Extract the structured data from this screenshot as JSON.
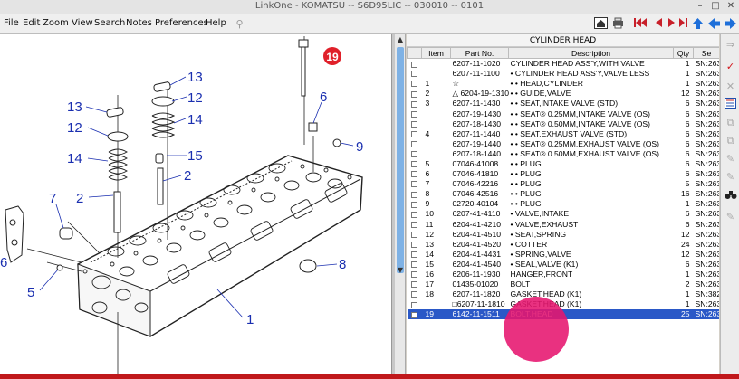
{
  "window": {
    "title": "LinkOne - KOMATSU -- S6D95LIC -- 030010 -- 0101"
  },
  "menu": [
    "File",
    "Edit",
    "Zoom",
    "View",
    "Search",
    "Notes",
    "Preferences",
    "Help"
  ],
  "parts_list": {
    "heading": "CYLINDER HEAD",
    "columns": [
      "Item",
      "Part No.",
      "Description",
      "Qty",
      "Se"
    ],
    "rows": [
      {
        "item": "",
        "part": "6207-11-1020",
        "desc": "CYLINDER HEAD ASS'Y,WITH VALVE",
        "qty": "1",
        "sn": "SN:263"
      },
      {
        "item": "",
        "part": "6207-11-1100",
        "desc": "• CYLINDER HEAD ASS'Y,VALVE LESS",
        "qty": "1",
        "sn": "SN:263"
      },
      {
        "item": "1",
        "part": "☆",
        "desc": "• • HEAD,CYLINDER",
        "qty": "1",
        "sn": "SN:263"
      },
      {
        "item": "2",
        "part": "△ 6204-19-1310",
        "desc": "• • GUIDE,VALVE",
        "qty": "12",
        "sn": "SN:263"
      },
      {
        "item": "3",
        "part": "6207-11-1430",
        "desc": "• • SEAT,INTAKE VALVE (STD)",
        "qty": "6",
        "sn": "SN:263"
      },
      {
        "item": "",
        "part": "6207-19-1430",
        "desc": "• • SEAT® 0.25MM,INTAKE VALVE (OS)",
        "qty": "6",
        "sn": "SN:263"
      },
      {
        "item": "",
        "part": "6207-18-1430",
        "desc": "• • SEAT® 0.50MM,INTAKE VALVE (OS)",
        "qty": "6",
        "sn": "SN:263"
      },
      {
        "item": "4",
        "part": "6207-11-1440",
        "desc": "• • SEAT,EXHAUST VALVE (STD)",
        "qty": "6",
        "sn": "SN:263"
      },
      {
        "item": "",
        "part": "6207-19-1440",
        "desc": "• • SEAT® 0.25MM,EXHAUST VALVE (OS)",
        "qty": "6",
        "sn": "SN:263"
      },
      {
        "item": "",
        "part": "6207-18-1440",
        "desc": "• • SEAT® 0.50MM,EXHAUST VALVE (OS)",
        "qty": "6",
        "sn": "SN:263"
      },
      {
        "item": "5",
        "part": "07046-41008",
        "desc": "• • PLUG",
        "qty": "6",
        "sn": "SN:263"
      },
      {
        "item": "6",
        "part": "07046-41810",
        "desc": "• • PLUG",
        "qty": "6",
        "sn": "SN:263"
      },
      {
        "item": "7",
        "part": "07046-42216",
        "desc": "• • PLUG",
        "qty": "5",
        "sn": "SN:263"
      },
      {
        "item": "8",
        "part": "07046-42516",
        "desc": "• • PLUG",
        "qty": "16",
        "sn": "SN:263"
      },
      {
        "item": "9",
        "part": "02720-40104",
        "desc": "• • PLUG",
        "qty": "1",
        "sn": "SN:263"
      },
      {
        "item": "10",
        "part": "6207-41-4110",
        "desc": "• VALVE,INTAKE",
        "qty": "6",
        "sn": "SN:263"
      },
      {
        "item": "11",
        "part": "6204-41-4210",
        "desc": "• VALVE,EXHAUST",
        "qty": "6",
        "sn": "SN:263"
      },
      {
        "item": "12",
        "part": "6204-41-4510",
        "desc": "• SEAT,SPRING",
        "qty": "12",
        "sn": "SN:263"
      },
      {
        "item": "13",
        "part": "6204-41-4520",
        "desc": "• COTTER",
        "qty": "24",
        "sn": "SN:263"
      },
      {
        "item": "14",
        "part": "6204-41-4431",
        "desc": "• SPRING,VALVE",
        "qty": "12",
        "sn": "SN:263"
      },
      {
        "item": "15",
        "part": "6204-41-4540",
        "desc": "• SEAL,VALVE (K1)",
        "qty": "6",
        "sn": "SN:263"
      },
      {
        "item": "16",
        "part": "6206-11-1930",
        "desc": "HANGER,FRONT",
        "qty": "1",
        "sn": "SN:263"
      },
      {
        "item": "17",
        "part": "01435-01020",
        "desc": "BOLT",
        "qty": "2",
        "sn": "SN:263"
      },
      {
        "item": "18",
        "part": "6207-11-1820",
        "desc": "GASKET,HEAD (K1)",
        "qty": "1",
        "sn": "SN:382"
      },
      {
        "item": "",
        "part": "□6207-11-1810",
        "desc": "GASKET,HEAD (K1)",
        "qty": "1",
        "sn": "SN:263"
      },
      {
        "item": "19",
        "part": "6142-11-1511",
        "desc": "BOLT,HEAD",
        "qty": "25",
        "sn": "SN:263"
      }
    ],
    "selected_item": "19"
  },
  "diagram": {
    "callouts": [
      {
        "id": "13a",
        "text": "13"
      },
      {
        "id": "12a",
        "text": "12"
      },
      {
        "id": "14a",
        "text": "14"
      },
      {
        "id": "15",
        "text": "15"
      },
      {
        "id": "2a",
        "text": "2"
      },
      {
        "id": "13b",
        "text": "13"
      },
      {
        "id": "12b",
        "text": "12"
      },
      {
        "id": "14b",
        "text": "14"
      },
      {
        "id": "7",
        "text": "7"
      },
      {
        "id": "2b",
        "text": "2"
      },
      {
        "id": "6a",
        "text": "6"
      },
      {
        "id": "9",
        "text": "9"
      },
      {
        "id": "6b",
        "text": "6"
      },
      {
        "id": "5",
        "text": "5"
      },
      {
        "id": "8",
        "text": "8"
      },
      {
        "id": "1",
        "text": "1"
      },
      {
        "id": "19",
        "text": "19"
      }
    ]
  },
  "colors": {
    "callout": "#1a2fb0",
    "selected_callout": "#e0202a",
    "selection": "#2a58c7",
    "cursor_highlight": "#e6146e"
  },
  "icons": [
    "back-icon",
    "forward-icon",
    "home-icon",
    "first-page-icon",
    "prev-page-icon",
    "next-page-icon",
    "last-page-icon",
    "up-icon"
  ]
}
